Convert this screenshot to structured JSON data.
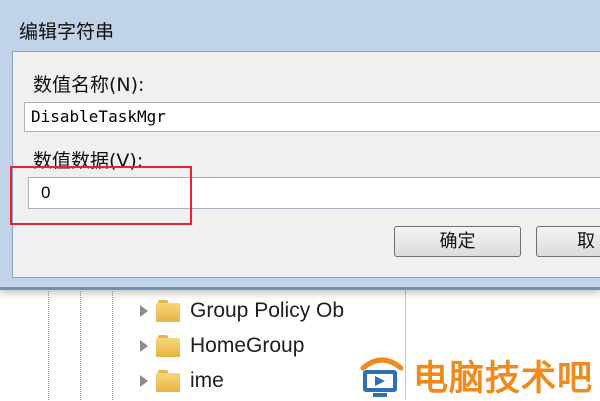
{
  "dialog": {
    "title": "编辑字符串",
    "name_label": "数值名称(N):",
    "name_value": "DisableTaskMgr",
    "data_label": "数值数据(V):",
    "data_value": "0",
    "ok_button": "确定",
    "cancel_button": "取"
  },
  "tree": {
    "items": [
      {
        "label": "Group Policy Ob"
      },
      {
        "label": "HomeGroup"
      },
      {
        "label": "ime"
      }
    ]
  },
  "watermark": {
    "text": "电脑技术吧",
    "color": "#f08a1c"
  },
  "highlight_color": "#e1262d"
}
